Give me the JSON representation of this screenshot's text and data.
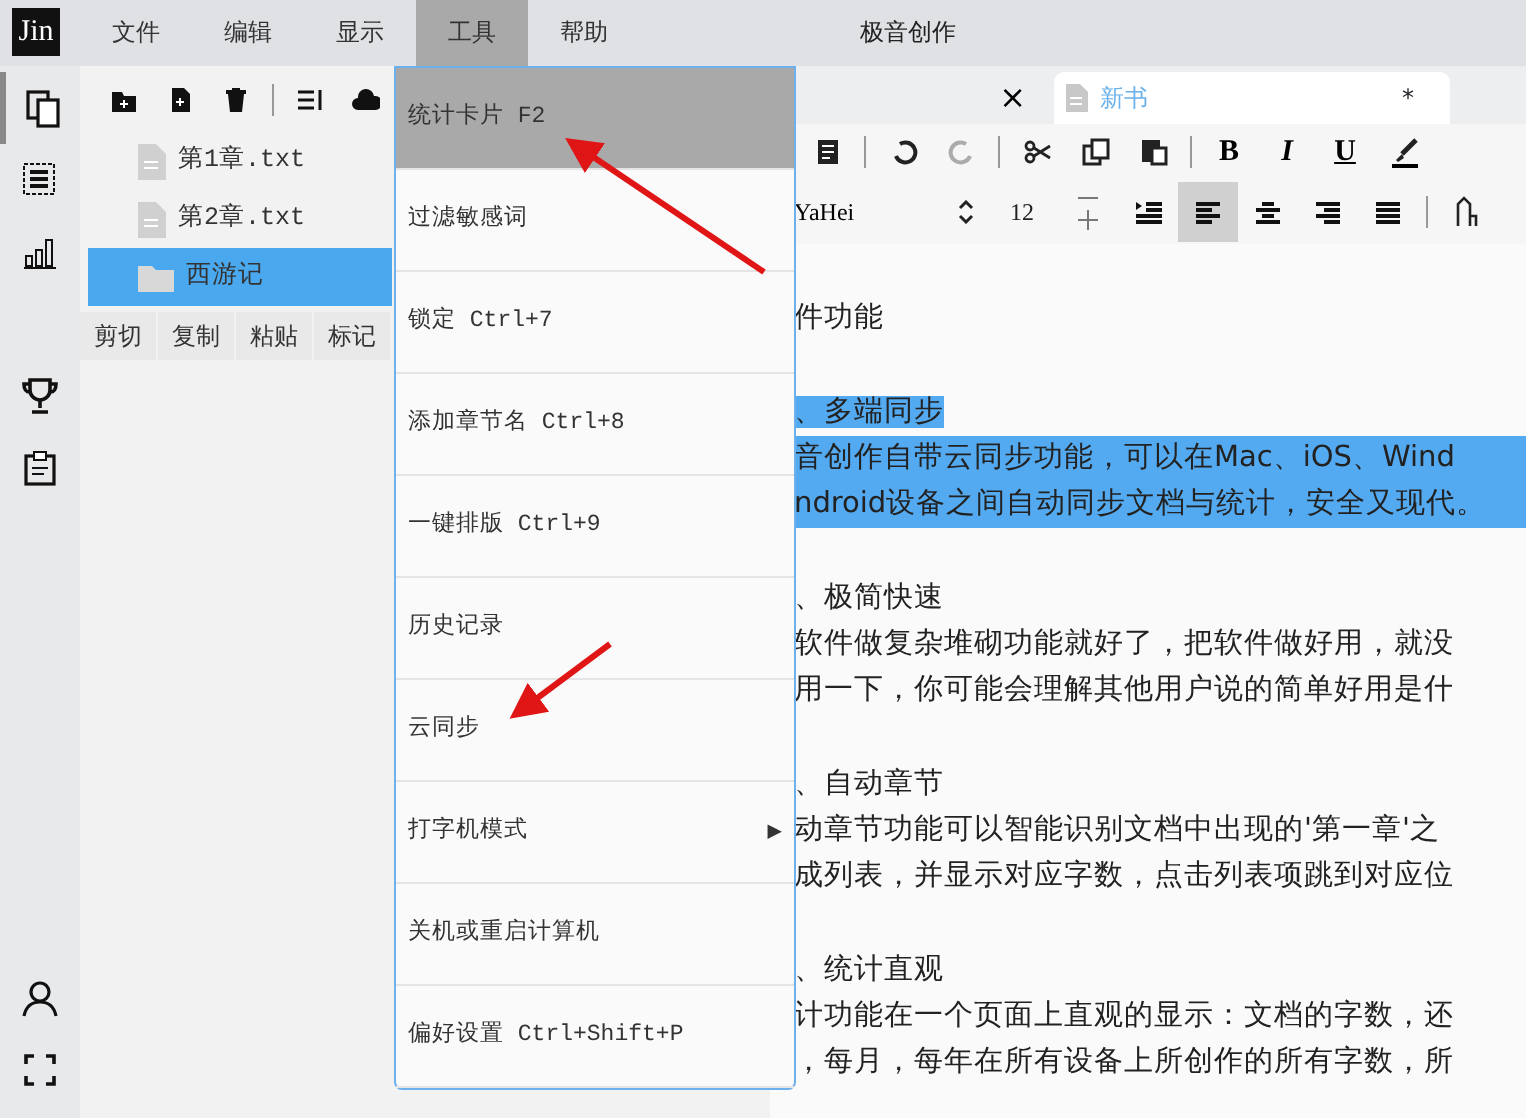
{
  "menu_bar": {
    "logo": "Jin",
    "items": [
      {
        "label": "文件",
        "selected": false
      },
      {
        "label": "编辑",
        "selected": false
      },
      {
        "label": "显示",
        "selected": false
      },
      {
        "label": "工具",
        "selected": true
      },
      {
        "label": "帮助",
        "selected": false
      }
    ],
    "title": "极音创作"
  },
  "rail": {
    "top": [
      {
        "kind": "files",
        "selected": true
      },
      {
        "kind": "outline",
        "selected": false
      },
      {
        "kind": "stats",
        "selected": false
      },
      {
        "kind": "trophy",
        "selected": false
      },
      {
        "kind": "notes",
        "selected": false
      }
    ],
    "bottom": [
      {
        "kind": "user"
      },
      {
        "kind": "fullscreen"
      }
    ]
  },
  "file_panel": {
    "toolbar": [
      {
        "kind": "new-folder"
      },
      {
        "kind": "new-file"
      },
      {
        "kind": "delete"
      },
      {
        "kind": "sep"
      },
      {
        "kind": "sort"
      },
      {
        "kind": "cloud"
      }
    ],
    "items": [
      {
        "kind": "file",
        "label": "第1章.txt",
        "selected": false
      },
      {
        "kind": "file",
        "label": "第2章.txt",
        "selected": false
      },
      {
        "kind": "folder",
        "label": "西游记",
        "selected": true
      }
    ],
    "actions": [
      "剪切",
      "复制",
      "粘贴",
      "标记"
    ]
  },
  "tools_menu": {
    "items": [
      {
        "label": "统计卡片 F2",
        "selected": true
      },
      {
        "label": "过滤敏感词",
        "selected": false
      },
      {
        "label": "锁定 Ctrl+7",
        "selected": false
      },
      {
        "label": "添加章节名 Ctrl+8",
        "selected": false
      },
      {
        "label": "一键排版 Ctrl+9",
        "selected": false
      },
      {
        "label": "历史记录",
        "selected": false
      },
      {
        "label": "云同步",
        "selected": false
      },
      {
        "label": "打字机模式",
        "selected": false,
        "arrow": "▶"
      },
      {
        "label": "关机或重启计算机",
        "selected": false
      },
      {
        "label": "偏好设置 Ctrl+Shift+P",
        "selected": false
      }
    ]
  },
  "editor": {
    "tabs": [
      {
        "selected": false,
        "close": "×"
      },
      {
        "label": "新书",
        "selected": true,
        "mark": "*"
      }
    ],
    "toolbar": [
      {
        "kind": "doc"
      },
      {
        "kind": "sep"
      },
      {
        "kind": "undo",
        "disabled": false
      },
      {
        "kind": "redo",
        "disabled": true
      },
      {
        "kind": "sep"
      },
      {
        "kind": "cut"
      },
      {
        "kind": "copy"
      },
      {
        "kind": "paste"
      },
      {
        "kind": "sep"
      },
      {
        "kind": "bold",
        "text": "B"
      },
      {
        "kind": "italic",
        "text": "I"
      },
      {
        "kind": "underline",
        "text": "U"
      },
      {
        "kind": "brush"
      }
    ],
    "format_bar": {
      "font": "YaHei",
      "size": "12",
      "align": [
        {
          "kind": "indent",
          "selected": false
        },
        {
          "kind": "left",
          "selected": true
        },
        {
          "kind": "center",
          "selected": false
        },
        {
          "kind": "right",
          "selected": false
        },
        {
          "kind": "justify",
          "selected": false
        }
      ]
    },
    "heading": "件功能",
    "sections": [
      {
        "title": "、多端同步",
        "highlighted": true,
        "lines": [
          "音创作自带云同步功能，可以在Mac、iOS、Wind",
          "ndroid设备之间自动同步文档与统计，安全又现代。"
        ]
      },
      {
        "title": "、极简快速",
        "highlighted": false,
        "lines": [
          "软件做复杂堆砌功能就好了，把软件做好用，就没",
          "用一下，你可能会理解其他用户说的简单好用是什"
        ]
      },
      {
        "title": "、自动章节",
        "highlighted": false,
        "lines": [
          "动章节功能可以智能识别文档中出现的'第一章'之",
          "成列表，并显示对应字数，点击列表项跳到对应位"
        ]
      },
      {
        "title": "、统计直观",
        "highlighted": false,
        "lines": [
          "计功能在一个页面上直观的显示：文档的字数，还",
          "，每月，每年在所有设备上所创作的所有字数，所"
        ]
      }
    ]
  }
}
